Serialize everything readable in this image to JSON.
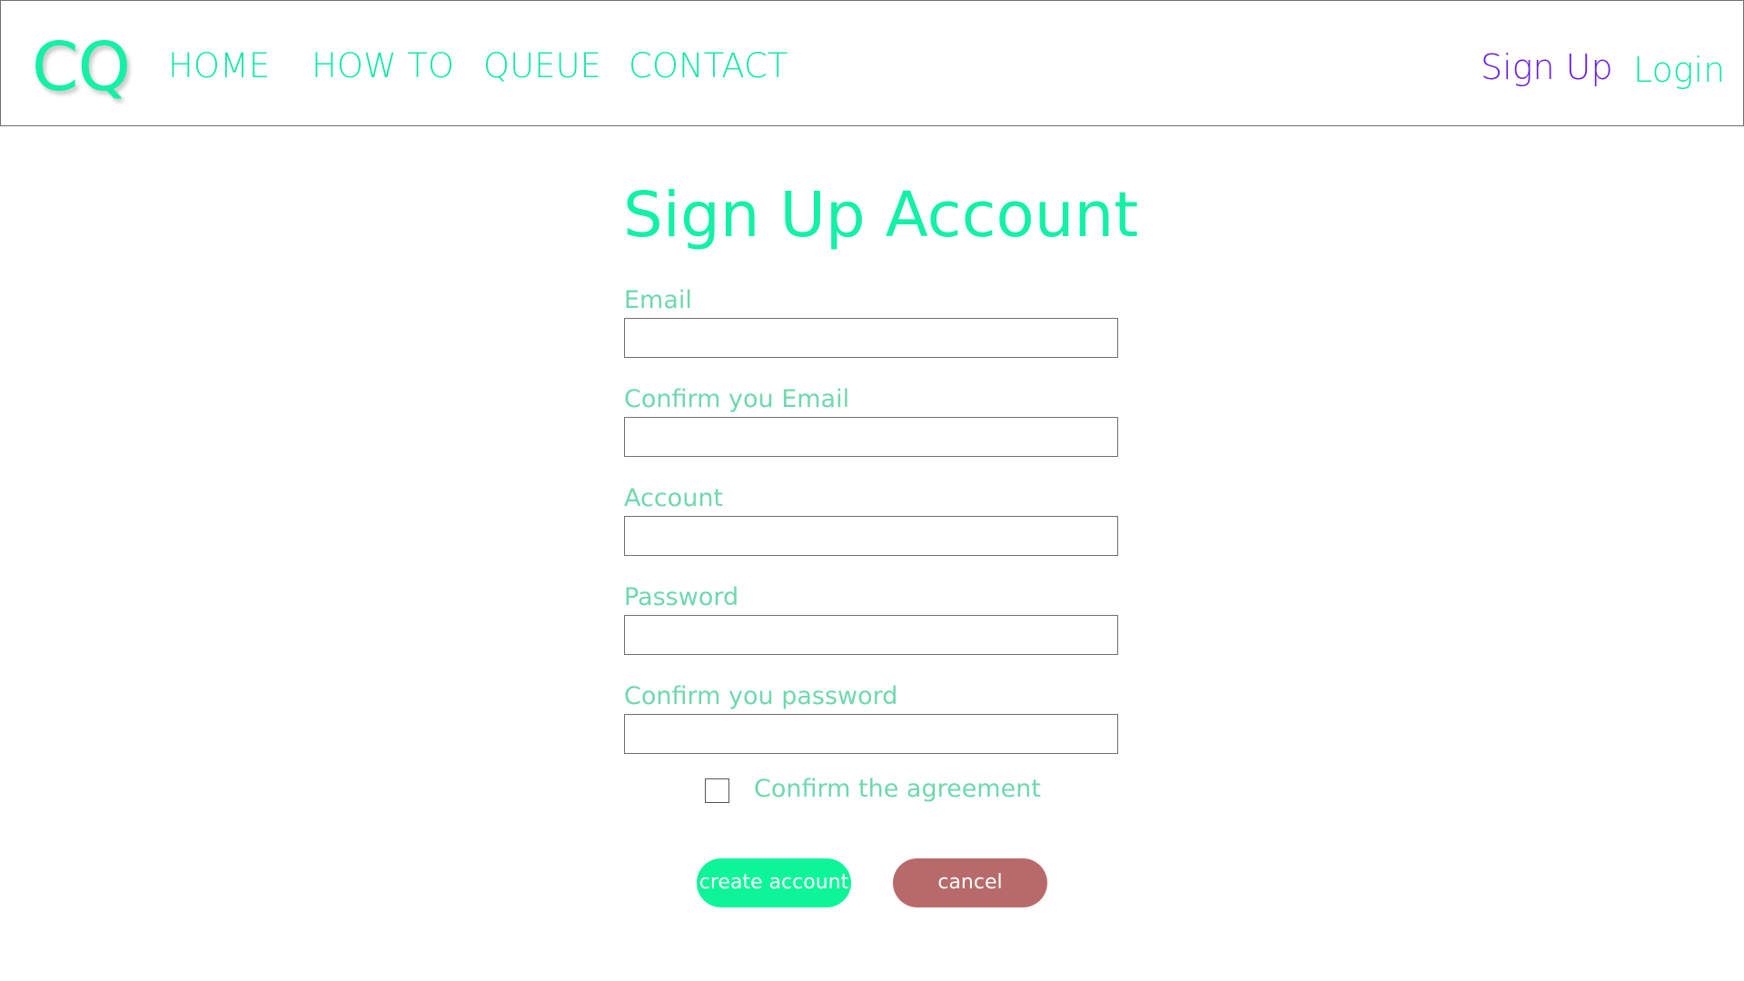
{
  "nav": {
    "logo": "CQ",
    "links": [
      "HOME",
      "HOW TO",
      "QUEUE",
      "CONTACT"
    ],
    "signup": "Sign Up",
    "login": "Login"
  },
  "page": {
    "title": "Sign Up Account"
  },
  "form": {
    "fields": [
      {
        "label": "Email",
        "value": ""
      },
      {
        "label": "Confirm you Email",
        "value": ""
      },
      {
        "label": "Account",
        "value": ""
      },
      {
        "label": "Password",
        "value": ""
      },
      {
        "label": "Confirm you password",
        "value": ""
      }
    ],
    "agreement": {
      "label": "Confirm the agreement",
      "checked": false
    },
    "create_label": "create account",
    "cancel_label": "cancel"
  },
  "colors": {
    "accent": "#14f0a6",
    "label": "#6fd8ad",
    "signup": "#6a1fe0",
    "create_button": "#0df598",
    "cancel_button": "#b86a6a"
  }
}
